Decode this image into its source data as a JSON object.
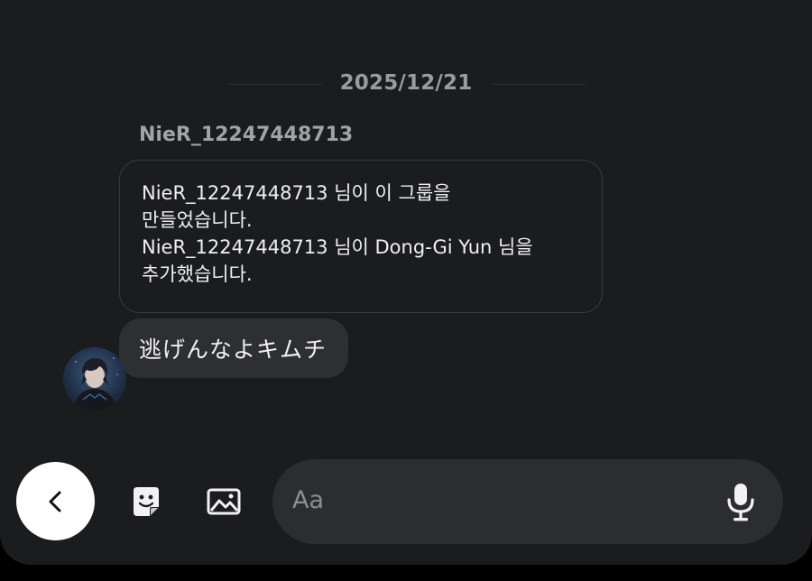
{
  "chat": {
    "date": "2025/12/21",
    "system_sender": "NieR_12247448713",
    "system_lines": [
      "NieR_12247448713 님이 이 그룹을",
      "만들었습니다.",
      "NieR_12247448713 님이 Dong-Gi Yun 님을",
      "추가했습니다."
    ],
    "message_text": "逃げんなよキムチ"
  },
  "composer": {
    "placeholder": "Aa"
  },
  "icons": {
    "back": "chevron-left-icon",
    "sticker": "sticker-icon",
    "gallery": "gallery-icon",
    "mic": "microphone-icon"
  },
  "colors": {
    "background": "#1b1c1e",
    "bubble": "#2e2f32",
    "text": "#f0f0f2",
    "muted": "#9a9b9f"
  }
}
